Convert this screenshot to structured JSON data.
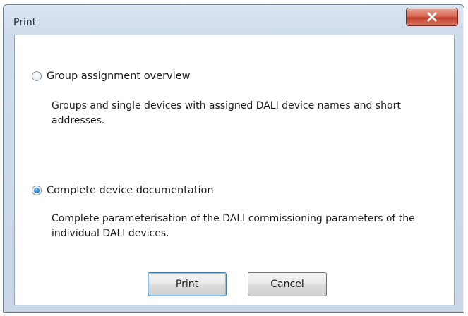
{
  "window": {
    "title": "Print"
  },
  "options": [
    {
      "label": "Group assignment overview",
      "description": "Groups and single devices with assigned DALI device names and short addresses.",
      "checked": false
    },
    {
      "label": "Complete device documentation",
      "description": "Complete parameterisation of the DALI commissioning parameters of the individual DALI devices.",
      "checked": true
    }
  ],
  "buttons": {
    "print_label": "Print",
    "cancel_label": "Cancel"
  },
  "icons": {
    "close": "close-icon"
  },
  "colors": {
    "close_button": "#c4412b",
    "radio_selected": "#2e82d6",
    "default_button_border": "#3c7fb1"
  }
}
